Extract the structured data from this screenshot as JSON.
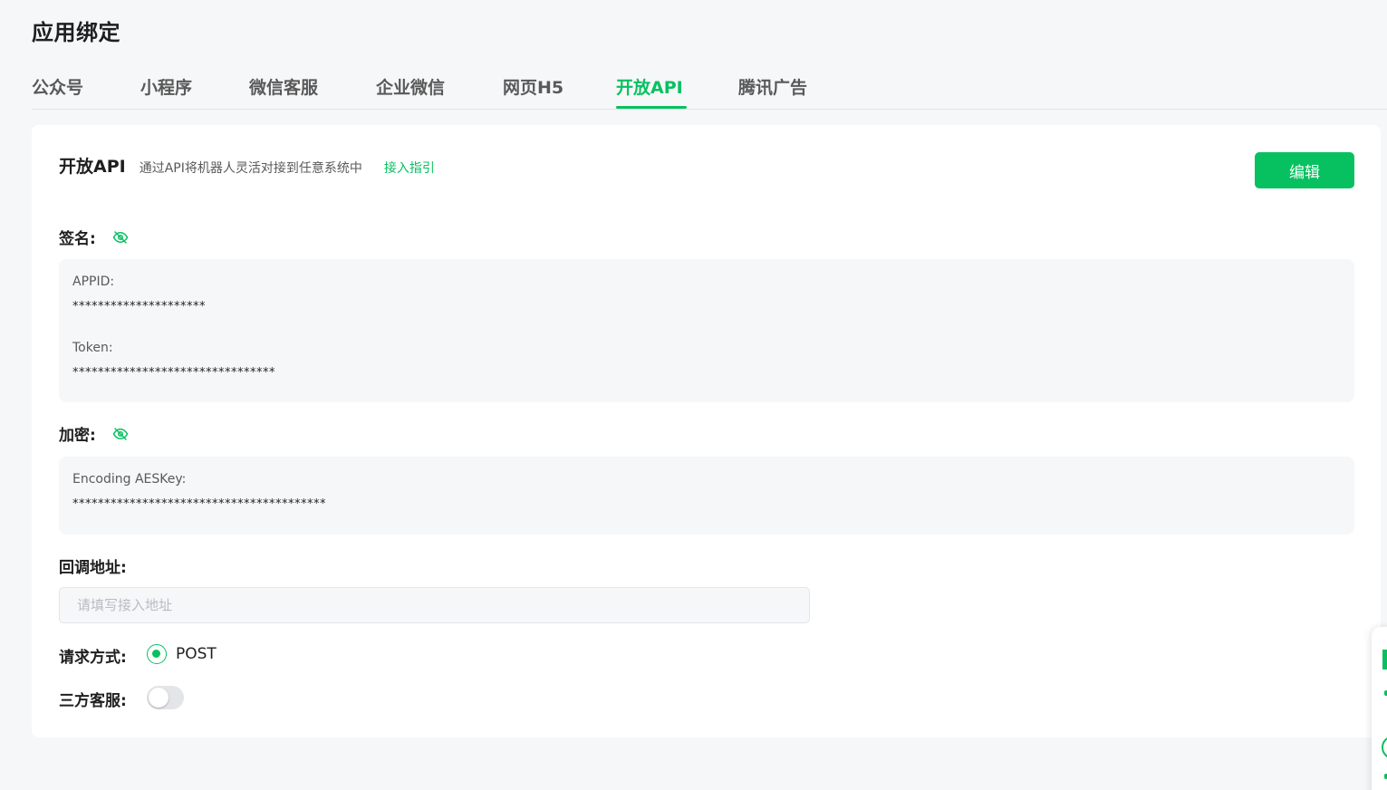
{
  "page": {
    "title": "应用绑定"
  },
  "tabs": [
    {
      "label": "公众号"
    },
    {
      "label": "小程序"
    },
    {
      "label": "微信客服"
    },
    {
      "label": "企业微信"
    },
    {
      "label": "网页H5"
    },
    {
      "label": "开放API",
      "active": true
    },
    {
      "label": "腾讯广告"
    }
  ],
  "card": {
    "title": "开放API",
    "description": "通过API将机器人灵活对接到任意系统中",
    "guide_link": "接入指引",
    "edit_button": "编辑"
  },
  "signature": {
    "label": "签名:",
    "eye_icon": "eye-off-icon",
    "appid_label": "APPID:",
    "appid_value": "*********************",
    "token_label": "Token:",
    "token_value": "********************************"
  },
  "encryption": {
    "label": "加密:",
    "eye_icon": "eye-off-icon",
    "aeskey_label": "Encoding AESKey:",
    "aeskey_value": "****************************************"
  },
  "callback": {
    "label": "回调地址:",
    "placeholder": "请填写接入地址",
    "value": ""
  },
  "request_method": {
    "label": "请求方式:",
    "option": "POST",
    "selected": true
  },
  "third_party_service": {
    "label": "三方客服:",
    "enabled": false
  },
  "colors": {
    "accent": "#07c160",
    "background": "#f6f7f9",
    "card": "#ffffff",
    "text": "#1f1f1f",
    "muted": "#595959"
  }
}
